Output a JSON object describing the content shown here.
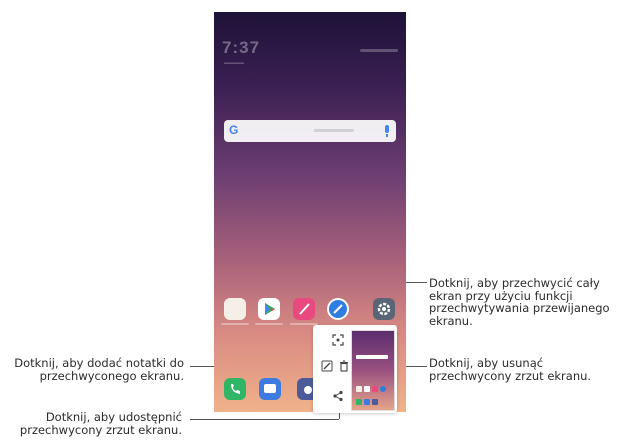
{
  "phone": {
    "clock": "7:37",
    "google_letter": "G"
  },
  "callouts": {
    "scroll_capture": "Dotknij, aby przechwycić cały ekran przy użyciu funkcji przechwytywania przewijanego ekranu.",
    "add_notes": "Dotknij, aby dodać notatki do przechwyconego ekranu.",
    "delete": "Dotknij, aby usunąć przechwycony zrzut ekranu.",
    "share": "Dotknij, aby udostępnić przechwycony zrzut ekranu."
  },
  "icons": {
    "scroll_capture": "extended-capture-icon",
    "edit": "pen-edit-icon",
    "delete": "trash-icon",
    "share": "share-icon"
  },
  "colors": {
    "wallpaper_top": "#1e1238",
    "wallpaper_bottom": "#f0b28a",
    "accent": "#4285F4"
  }
}
